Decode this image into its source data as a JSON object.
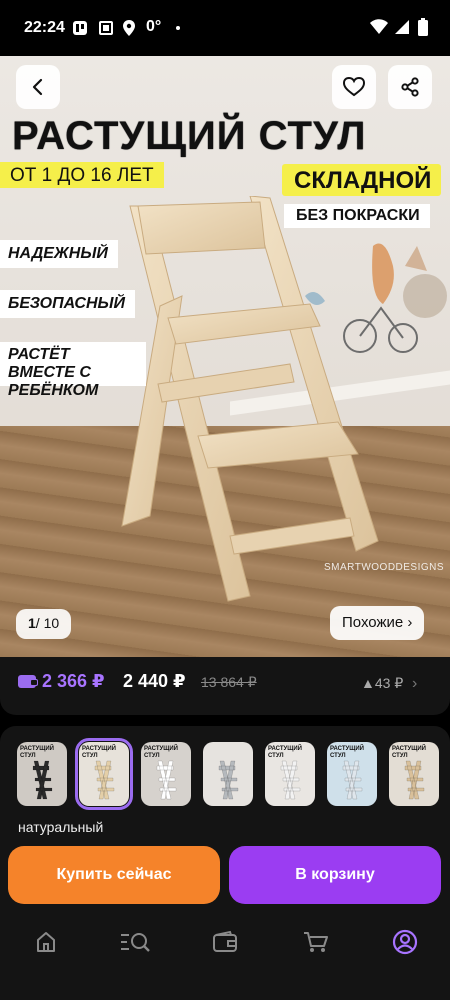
{
  "status_bar": {
    "time": "22:24",
    "signal_text": "0°"
  },
  "hero": {
    "title": "РАСТУЩИЙ СТУЛ",
    "tags": {
      "age": "ОТ 1 ДО 16 ЛЕТ",
      "foldable": "СКЛАДНОЙ",
      "no_paint": "БЕЗ ПОКРАСКИ",
      "reliable": "НАДЕЖНЫЙ",
      "safe": "БЕЗОПАСНЫЙ",
      "grows": "РАСТЁТ ВМЕСТЕ С РЕБЁНКОМ"
    },
    "watermark": "SMARTWOODDESIGNS",
    "counter_current": "1",
    "counter_total": "/ 10",
    "similar_label": "Похожие ›",
    "icons": {
      "back": "chevron-left-icon",
      "favorite": "heart-icon",
      "share": "share-icon"
    }
  },
  "price": {
    "card_price": "2 366 ₽",
    "current_price": "2 440 ₽",
    "old_price": "13 864 ₽",
    "rating_text": "▲43 ₽",
    "chevron": "›",
    "accent_color": "#a874ff"
  },
  "variants": {
    "items": [
      {
        "title": "РАСТУЩИЙ СТУЛ",
        "bg": "#cfcac4",
        "chair": "#2a2a2a"
      },
      {
        "title": "РАСТУЩИЙ СТУЛ",
        "bg": "#e7e2da",
        "chair": "#e4cfa8"
      },
      {
        "title": "РАСТУЩИЙ СТУЛ",
        "bg": "#d6d2cd",
        "chair": "#ffffff"
      },
      {
        "title": "",
        "bg": "#e6e3df",
        "chair": "#b5b9bd"
      },
      {
        "title": "РАСТУЩИЙ СТУЛ",
        "bg": "#e9e6e2",
        "chair": "#f2f2f2"
      },
      {
        "title": "РАСТУЩИЙ СТУЛ",
        "bg": "#cfe0ea",
        "chair": "#dfe6ec"
      },
      {
        "title": "РАСТУЩИЙ СТУЛ",
        "bg": "#e3ddd4",
        "chair": "#d9c09a"
      }
    ],
    "selected_index": 1,
    "selected_label": "натуральный"
  },
  "actions": {
    "buy_now": "Купить сейчас",
    "add_to_cart": "В корзину",
    "buy_color": "#f5832a",
    "cart_color": "#9b3df2"
  },
  "bottom_nav": {
    "items": [
      "home-icon",
      "catalog-search-icon",
      "wallet-icon",
      "cart-icon",
      "profile-icon"
    ],
    "active": "profile-icon",
    "active_color": "#a874ff"
  }
}
